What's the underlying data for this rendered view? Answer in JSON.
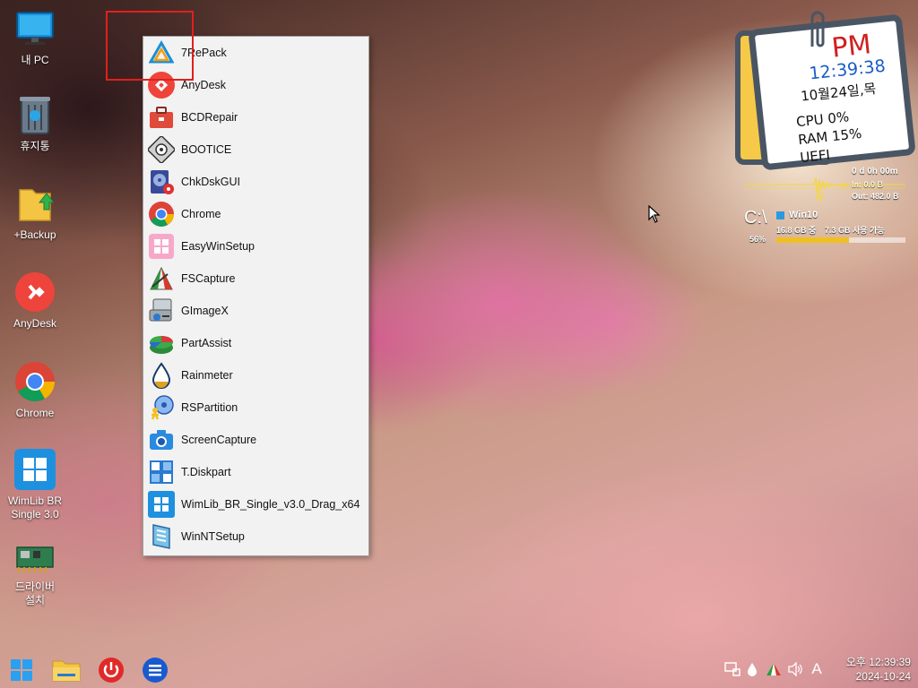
{
  "desktop_icons": [
    {
      "label": "내 PC",
      "icon": "monitor-icon"
    },
    {
      "label": "휴지통",
      "icon": "recycle-bin-icon"
    },
    {
      "label": "+Backup",
      "icon": "folder-backup-icon"
    },
    {
      "label": "AnyDesk",
      "icon": "anydesk-icon"
    },
    {
      "label": "Chrome",
      "icon": "chrome-icon"
    },
    {
      "label": "WimLib BR Single 3.0",
      "icon": "windows-icon"
    },
    {
      "label": "드라이버 설치",
      "icon": "driver-card-icon"
    }
  ],
  "menu": {
    "items": [
      {
        "label": "7RePack",
        "icon": "7repack-icon"
      },
      {
        "label": "AnyDesk",
        "icon": "anydesk-icon"
      },
      {
        "label": "BCDRepair",
        "icon": "toolbox-icon"
      },
      {
        "label": "BOOTICE",
        "icon": "disk-icon"
      },
      {
        "label": "ChkDskGUI",
        "icon": "hdd-gear-icon"
      },
      {
        "label": "Chrome",
        "icon": "chrome-icon"
      },
      {
        "label": "EasyWinSetup",
        "icon": "windows-pink-icon"
      },
      {
        "label": "FSCapture",
        "icon": "fscapture-icon"
      },
      {
        "label": "GImageX",
        "icon": "gimagex-icon"
      },
      {
        "label": "PartAssist",
        "icon": "partassist-icon"
      },
      {
        "label": "Rainmeter",
        "icon": "rainmeter-drop-icon"
      },
      {
        "label": "RSPartition",
        "icon": "rspartition-icon"
      },
      {
        "label": "ScreenCapture",
        "icon": "camera-icon"
      },
      {
        "label": "T.Diskpart",
        "icon": "tdiskpart-icon"
      },
      {
        "label": "WimLib_BR_Single_v3.0_Drag_x64",
        "icon": "windows-icon"
      },
      {
        "label": "WinNTSetup",
        "icon": "winntsetup-icon"
      }
    ]
  },
  "clock_widget": {
    "ampm": "PM",
    "time": "12:39:38",
    "date": "10월24일,목",
    "cpu": "CPU  0%",
    "ram": "RAM  15%",
    "boot": "UEFI"
  },
  "net_widget": {
    "uptime": "0 d 0h 00m",
    "in": "In: 0.0 B",
    "out": "Out: 482.0 B"
  },
  "disk_widget": {
    "drive": "C:\\",
    "percent": "56%",
    "name": "Win10",
    "total": "16.8 GB 중",
    "free": "7.3 GB 사용 가능",
    "used_fraction": 0.56
  },
  "taskbar": {
    "clock_line1": "오후 12:39:39",
    "clock_line2": "2024-10-24",
    "ime": "A"
  },
  "colors": {
    "highlight": "#e0201c",
    "disk_bar": "#f0c020",
    "clock_time": "#1a5cc8",
    "clock_pm": "#d02020"
  }
}
